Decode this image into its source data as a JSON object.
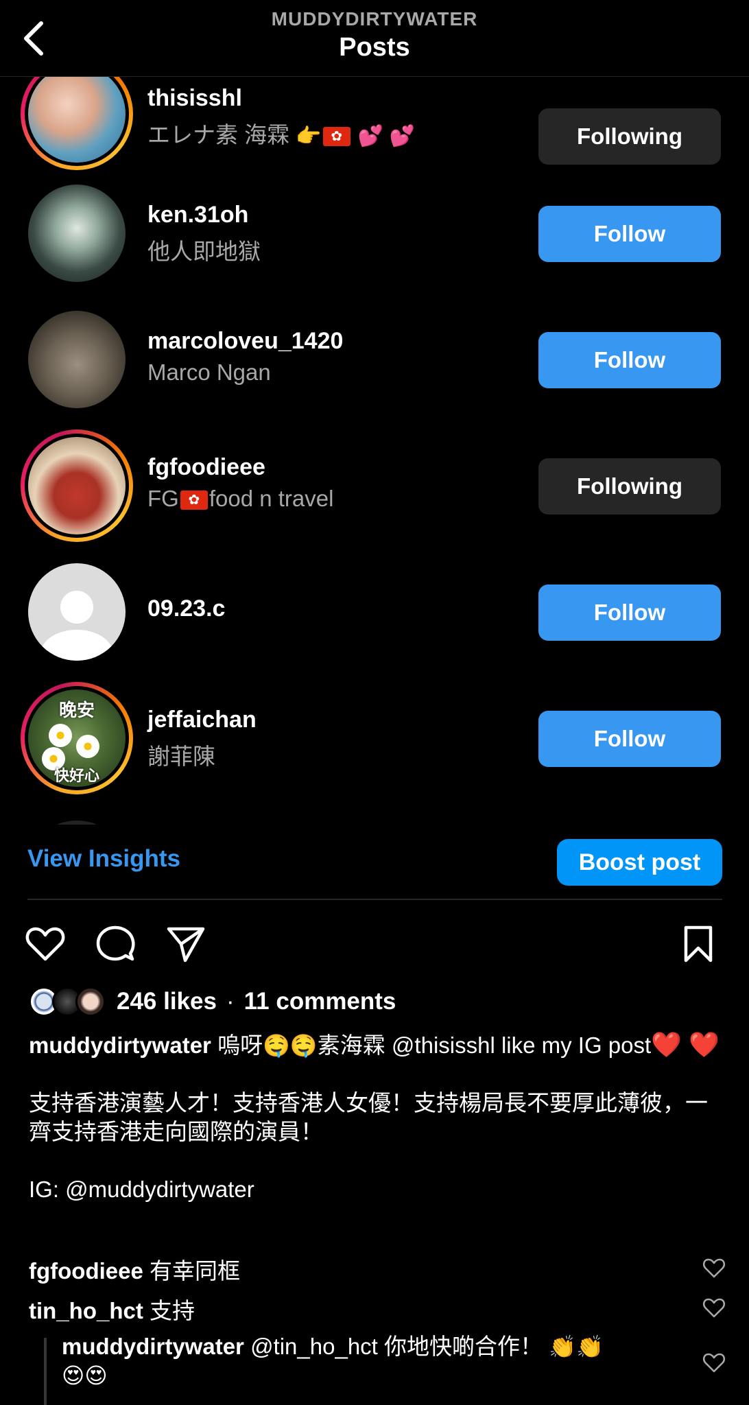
{
  "header": {
    "account": "MUDDYDIRTYWATER",
    "title": "Posts"
  },
  "likers": [
    {
      "username": "thisisshl",
      "fullname": "エレナ素 海霖",
      "button": "Following"
    },
    {
      "username": "ken.31oh",
      "fullname": "他人即地獄",
      "button": "Follow"
    },
    {
      "username": "marcoloveu_1420",
      "fullname": "Marco Ngan",
      "button": "Follow"
    },
    {
      "username": "fgfoodieee",
      "fullname_pre": "FG",
      "fullname_post": "food n travel",
      "button": "Following"
    },
    {
      "username": "09.23.c",
      "fullname": "",
      "button": "Follow"
    },
    {
      "username": "jeffaichan",
      "fullname": "謝菲陳",
      "button": "Follow",
      "avatar_text_top": "晚安",
      "avatar_text_bottom": "快好心"
    }
  ],
  "actions": {
    "insights": "View Insights",
    "boost": "Boost post"
  },
  "icons": [
    "heart-icon",
    "comment-icon",
    "share-icon",
    "bookmark-icon"
  ],
  "stats": {
    "likes": "246 likes",
    "separator": "·",
    "comments": "11 comments"
  },
  "caption": {
    "author": "muddydirtywater",
    "line1_a": "嗚呀",
    "line1_b": "素海霖 @thisisshl like my IG post",
    "para2": "支持香港演藝人才！支持香港人女優！支持楊局長不要厚此薄彼，一齊支持香港走向國際的演員！",
    "para3": "IG: @muddydirtywater"
  },
  "comments": [
    {
      "user": "fgfoodieee",
      "text": "有幸同框"
    },
    {
      "user": "tin_ho_hct",
      "text": "支持"
    }
  ],
  "reply": {
    "user": "muddydirtywater",
    "text": "@tin_ho_hct 你地快啲合作！"
  },
  "colors": {
    "accent": "#3897f0",
    "boost": "#0095f6",
    "following_bg": "#262626",
    "muted": "#a8a8a8"
  }
}
